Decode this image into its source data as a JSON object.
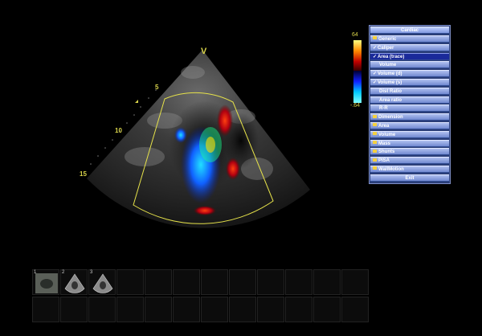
{
  "depth_marks": [
    "5",
    "10",
    "15"
  ],
  "probe_marker": "V",
  "color_scale": {
    "max": "64",
    "min": "-.64",
    "positive_color": "#ff5a00",
    "negative_color": "#00c8ff"
  },
  "menu": {
    "title": "Cardiac",
    "items": [
      {
        "label": "Generic",
        "icon": "folder-icon",
        "state": "folder"
      },
      {
        "label": "Caliper",
        "icon": "check-icon",
        "state": "checked"
      },
      {
        "label": "Area (trace)",
        "icon": "check-icon",
        "state": "selected"
      },
      {
        "label": "Volume",
        "icon": "",
        "state": "plain"
      },
      {
        "label": "Volume (d)",
        "icon": "check-icon",
        "state": "checked"
      },
      {
        "label": "Volume (s)",
        "icon": "check-icon",
        "state": "checked"
      },
      {
        "label": "Dist Ratio",
        "icon": "",
        "state": "plain"
      },
      {
        "label": "Area ratio",
        "icon": "",
        "state": "plain"
      },
      {
        "label": "R-R",
        "icon": "",
        "state": "plain"
      },
      {
        "label": "Dimension",
        "icon": "folder-icon",
        "state": "folder"
      },
      {
        "label": "Area",
        "icon": "folder-icon",
        "state": "folder"
      },
      {
        "label": "Volume",
        "icon": "folder-icon",
        "state": "folder"
      },
      {
        "label": "Mass",
        "icon": "folder-icon",
        "state": "folder"
      },
      {
        "label": "Shunts",
        "icon": "folder-icon",
        "state": "folder"
      },
      {
        "label": "PISA",
        "icon": "folder-icon",
        "state": "folder"
      },
      {
        "label": "WallMotion",
        "icon": "folder-icon",
        "state": "folder"
      }
    ],
    "exit_label": "Exit"
  },
  "thumbnails": [
    {
      "number": "1",
      "icon": "echo-thumbnail-icon"
    },
    {
      "number": "2",
      "icon": "sector-thumbnail-icon"
    },
    {
      "number": "3",
      "icon": "sector-thumbnail-icon"
    }
  ]
}
